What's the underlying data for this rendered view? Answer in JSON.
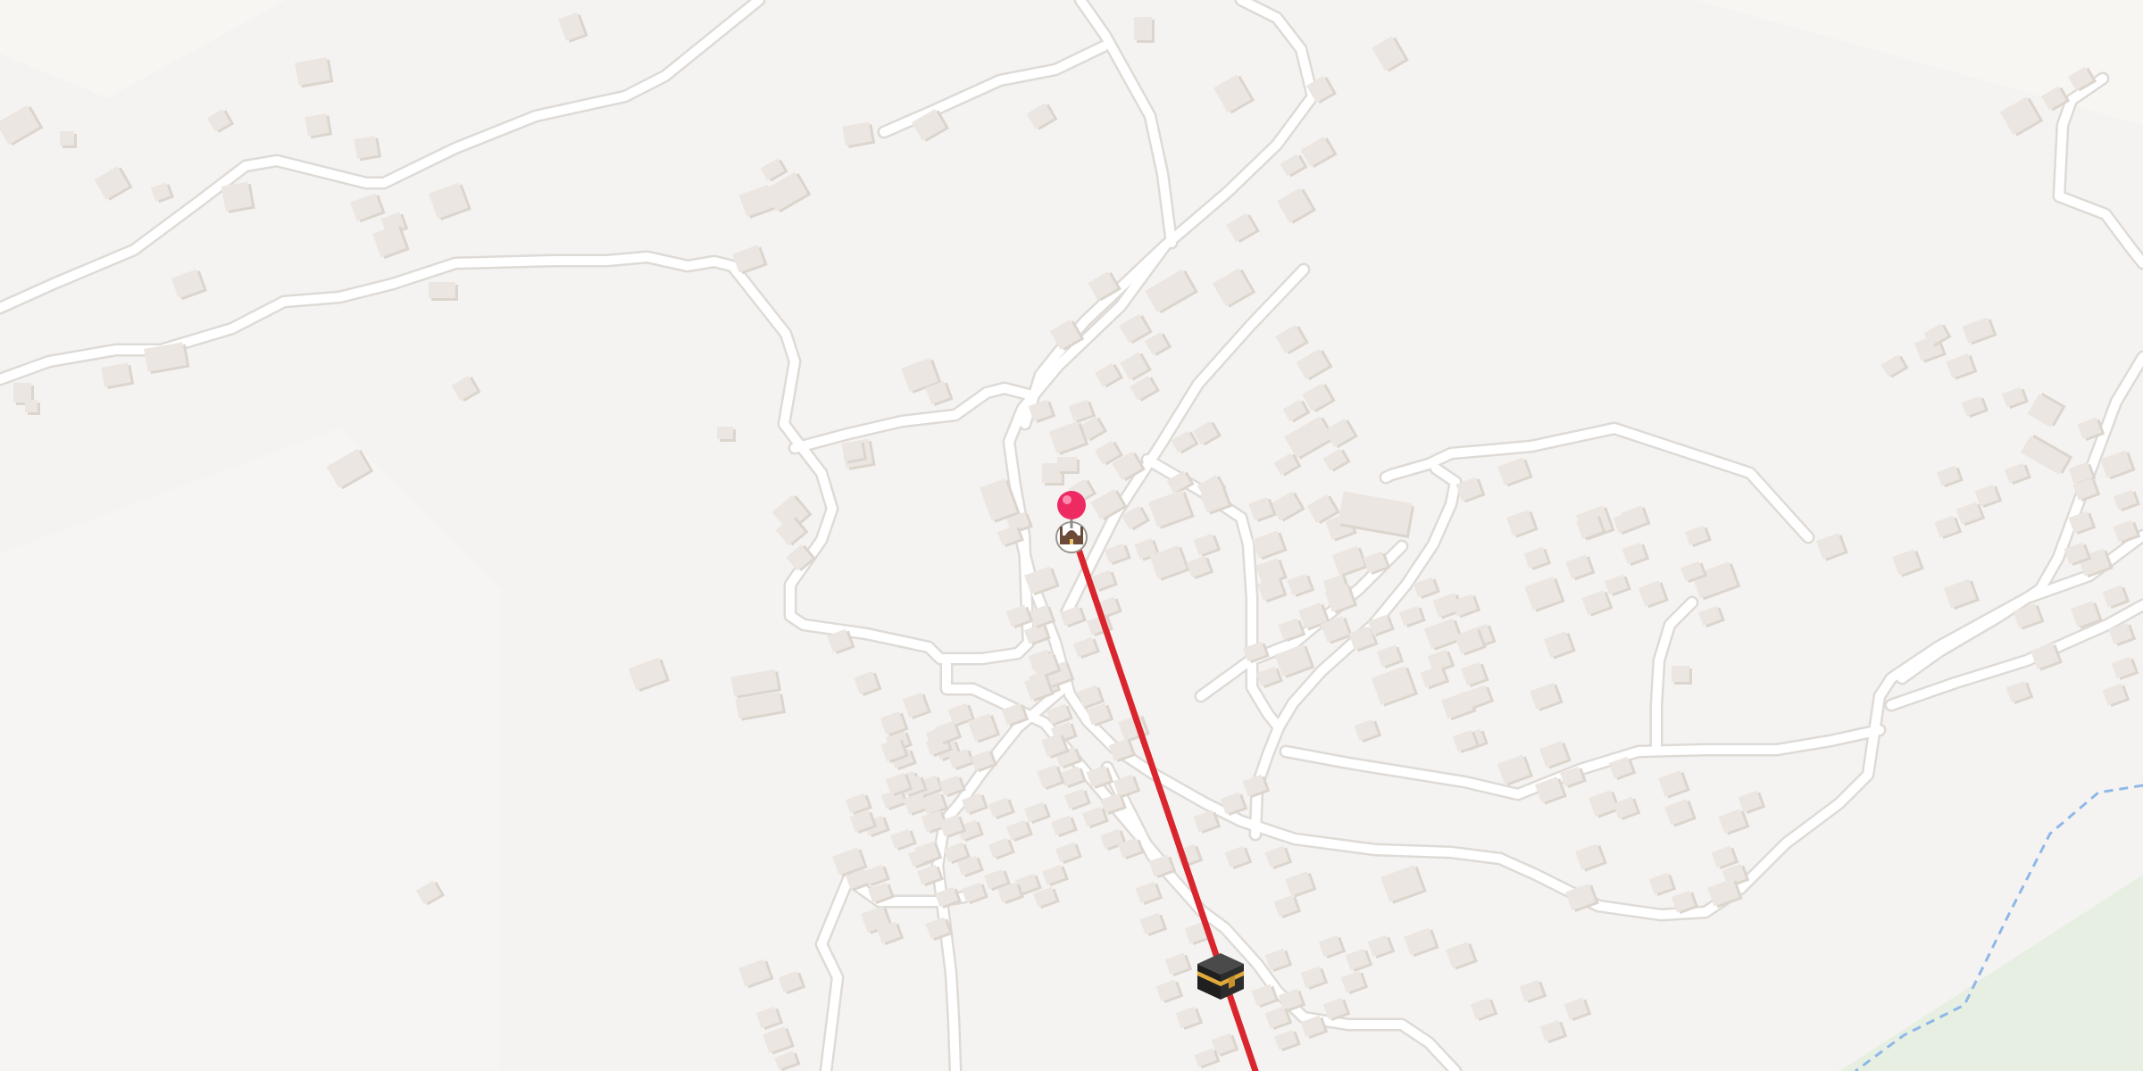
{
  "map": {
    "colors": {
      "background": "#f5f3f1",
      "road": "#ffffff",
      "building": "#ebe6e1",
      "park": "#e7efe2",
      "boundary": "#8fb8e8",
      "qibla_line": "#d9252d",
      "pin": "#ee2a63"
    },
    "markers": [
      {
        "id": "location-pin",
        "icon": "red-pin-icon"
      },
      {
        "id": "mosque",
        "icon": "mosque-icon"
      },
      {
        "id": "kaaba",
        "icon": "kaaba-icon"
      }
    ],
    "overlay": {
      "qibla_direction_line": true
    },
    "boundary_style": "dashed-blue"
  }
}
